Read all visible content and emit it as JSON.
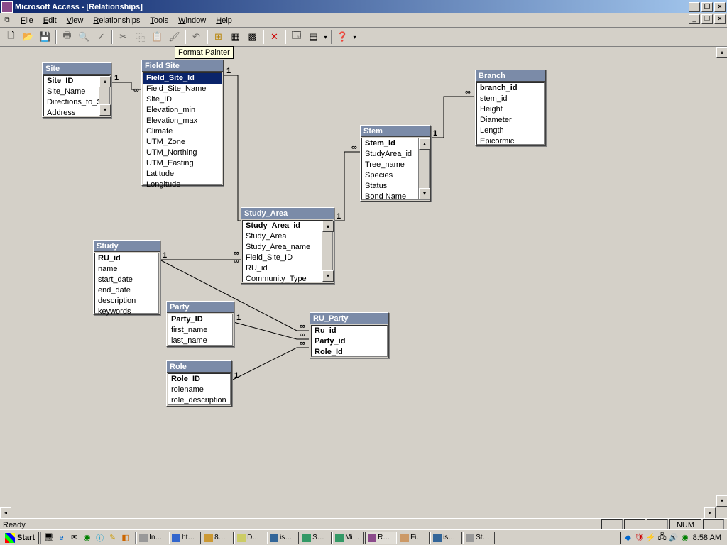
{
  "title": "Microsoft Access - [Relationships]",
  "menu": [
    "File",
    "Edit",
    "View",
    "Relationships",
    "Tools",
    "Window",
    "Help"
  ],
  "tooltip": "Format Painter",
  "tables": {
    "site": {
      "title": "Site",
      "fields": [
        "Site_ID",
        "Site_Name",
        "Directions_to_Si",
        "Address"
      ],
      "bold": [
        0
      ]
    },
    "fieldsite": {
      "title": "Field Site",
      "fields": [
        "Field_Site_Id",
        "Field_Site_Name",
        "Site_ID",
        "Elevation_min",
        "Elevation_max",
        "Climate",
        "UTM_Zone",
        "UTM_Northing",
        "UTM_Easting",
        "Latitude",
        "Longitude"
      ],
      "bold": [
        0
      ],
      "sel": 0
    },
    "study": {
      "title": "Study",
      "fields": [
        "RU_id",
        "name",
        "start_date",
        "end_date",
        "description",
        "keywords"
      ],
      "bold": [
        0
      ]
    },
    "studyarea": {
      "title": "Study_Area",
      "fields": [
        "Study_Area_id",
        "Study_Area",
        "Study_Area_name",
        "Field_Site_ID",
        "RU_id",
        "Community_Type"
      ],
      "bold": [
        0
      ]
    },
    "party": {
      "title": "Party",
      "fields": [
        "Party_ID",
        "first_name",
        "last_name"
      ],
      "bold": [
        0
      ]
    },
    "role": {
      "title": "Role",
      "fields": [
        "Role_ID",
        "rolename",
        "role_description"
      ],
      "bold": [
        0
      ]
    },
    "ruparty": {
      "title": "RU_Party",
      "fields": [
        "Ru_id",
        "Party_id",
        "Role_Id"
      ],
      "bold": [
        0,
        1,
        2
      ]
    },
    "stem": {
      "title": "Stem",
      "fields": [
        "Stem_id",
        "StudyArea_id",
        "Tree_name",
        "Species",
        "Status",
        "Bond Name"
      ],
      "bold": [
        0
      ]
    },
    "branch": {
      "title": "Branch",
      "fields": [
        "branch_id",
        "stem_id",
        "Height",
        "Diameter",
        "Length",
        "Epicormic"
      ],
      "bold": [
        0
      ]
    }
  },
  "status": {
    "ready": "Ready",
    "num": "NUM"
  },
  "taskbar": {
    "start": "Start",
    "tasks": [
      "In…",
      "ht…",
      "8…",
      "D…",
      "is…",
      "S…",
      "Mi…",
      "R…",
      "Fi…",
      "is…",
      "St…"
    ],
    "active": 7,
    "clock": "8:58 AM"
  }
}
